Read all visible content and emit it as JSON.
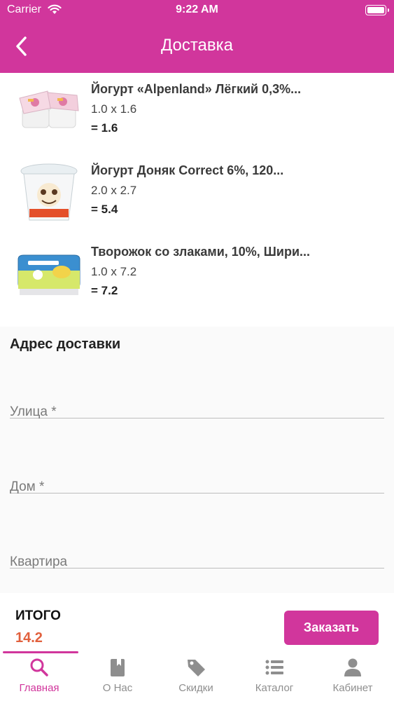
{
  "status_bar": {
    "carrier": "Carrier",
    "time": "9:22 AM"
  },
  "nav": {
    "title": "Доставка"
  },
  "items": [
    {
      "name": "Йогурт «Alpenland» Лёгкий 0,3%...",
      "qty": "1.0 x 1.6",
      "total": "= 1.6"
    },
    {
      "name": "Йогурт Доняк Correct 6%, 120...",
      "qty": "2.0 x 2.7",
      "total": "= 5.4"
    },
    {
      "name": "Творожок со злаками, 10%, Шири...",
      "qty": "1.0 x 7.2",
      "total": "= 7.2"
    }
  ],
  "address": {
    "title": "Адрес доставки",
    "fields": [
      {
        "placeholder": "Улица *"
      },
      {
        "placeholder": "Дом *"
      },
      {
        "placeholder": "Квартира"
      }
    ]
  },
  "summary": {
    "label": "ИТОГО",
    "value": "14.2",
    "order_button": "Заказать"
  },
  "tabs": [
    {
      "label": "Главная",
      "icon": "search-icon",
      "active": true
    },
    {
      "label": "О Нас",
      "icon": "book-icon",
      "active": false
    },
    {
      "label": "Скидки",
      "icon": "tag-icon",
      "active": false
    },
    {
      "label": "Каталог",
      "icon": "list-icon",
      "active": false
    },
    {
      "label": "Кабинет",
      "icon": "person-icon",
      "active": false
    }
  ],
  "colors": {
    "accent": "#d1369c",
    "total_value": "#e1603d",
    "inactive_tab": "#8e8e8e"
  }
}
